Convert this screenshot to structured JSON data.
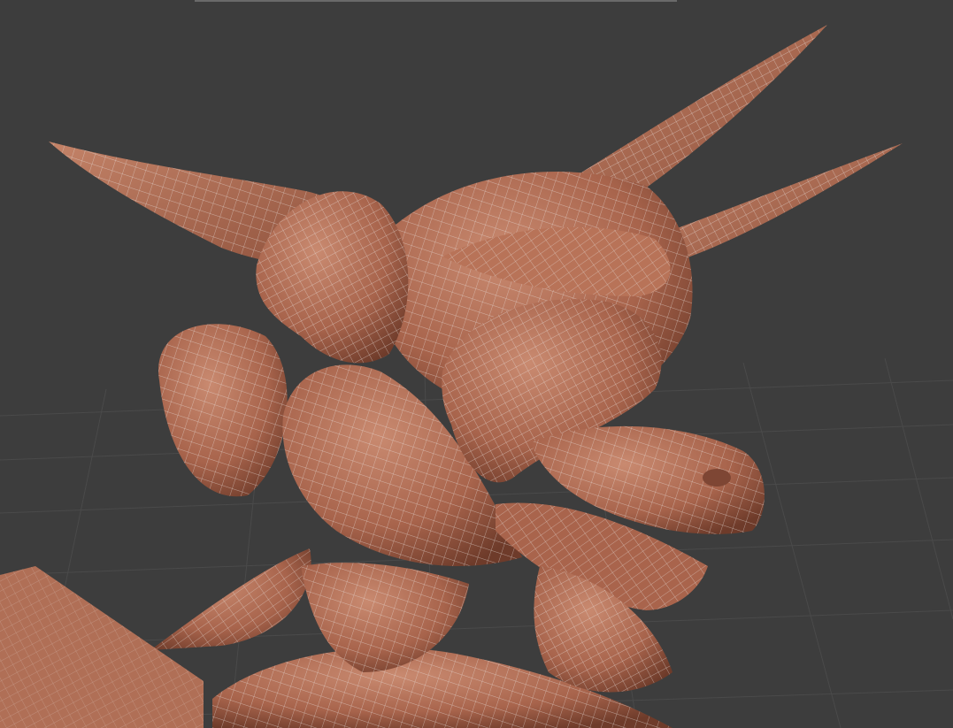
{
  "viewport": {
    "background_color": "#3d3d3d",
    "grid_color": "#4a4a4a",
    "model_color": "#b7725a",
    "wireframe_color": "#e8e0dc",
    "shading_mode": "smooth-shaded-with-wireframe",
    "show_grid": true
  },
  "scene": {
    "objects": [
      {
        "name_icon": "horn-left-long-icon"
      },
      {
        "name_icon": "horn-right-upper-icon"
      },
      {
        "name_icon": "horn-right-lower-icon"
      },
      {
        "name_icon": "head-mesh-icon"
      },
      {
        "name_icon": "snout-mesh-icon"
      },
      {
        "name_icon": "jaw-mesh-icon"
      },
      {
        "name_icon": "body-block-icon"
      }
    ]
  }
}
